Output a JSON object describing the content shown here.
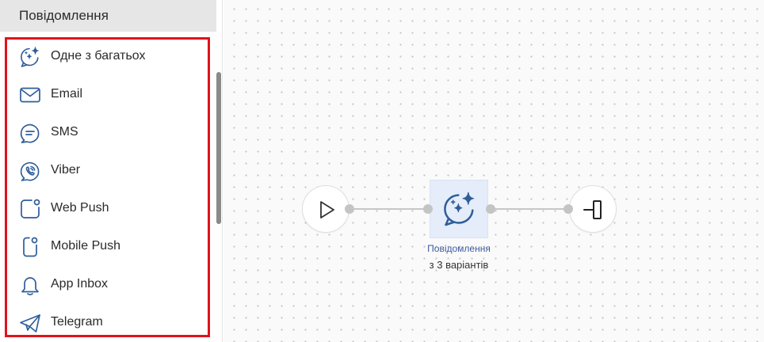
{
  "panel": {
    "title": "Повідомлення",
    "items": [
      {
        "label": "Одне з багатьох",
        "icon": "sparkle-chat-icon"
      },
      {
        "label": "Email",
        "icon": "envelope-icon"
      },
      {
        "label": "SMS",
        "icon": "chat-bubble-icon"
      },
      {
        "label": "Viber",
        "icon": "viber-icon"
      },
      {
        "label": "Web Push",
        "icon": "web-push-icon"
      },
      {
        "label": "Mobile Push",
        "icon": "mobile-push-icon"
      },
      {
        "label": "App Inbox",
        "icon": "bell-icon"
      },
      {
        "label": "Telegram",
        "icon": "paper-plane-icon"
      }
    ]
  },
  "canvas": {
    "node": {
      "title": "Повідомлення",
      "subtitle": "з 3 варіантів",
      "icon": "sparkle-chat-icon"
    },
    "start_icon": "play-icon",
    "end_icon": "exit-icon"
  },
  "colors": {
    "icon_stroke": "#2f5d9a",
    "highlight_border": "#e0131b",
    "node_background": "#e5ecfa",
    "header_background": "#e6e6e6"
  }
}
